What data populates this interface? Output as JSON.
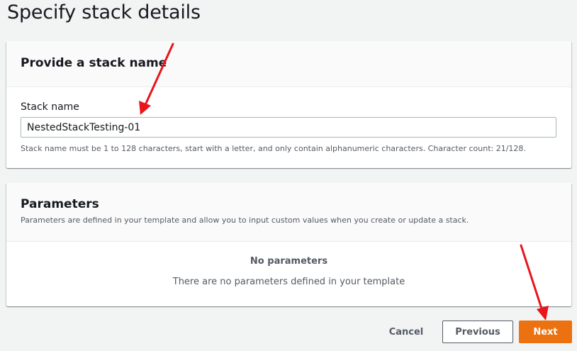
{
  "page": {
    "title": "Specify stack details"
  },
  "stack_name_section": {
    "title": "Provide a stack name",
    "field_label": "Stack name",
    "field_value": "NestedStackTesting-01",
    "constraint": "Stack name must be 1 to 128 characters, start with a letter, and only contain alphanumeric characters. Character count: 21/128."
  },
  "parameters_section": {
    "title": "Parameters",
    "description": "Parameters are defined in your template and allow you to input custom values when you create or update a stack.",
    "empty_title": "No parameters",
    "empty_description": "There are no parameters defined in your template"
  },
  "actions": {
    "cancel_label": "Cancel",
    "previous_label": "Previous",
    "next_label": "Next"
  },
  "colors": {
    "primary_button": "#ec7211",
    "annotation_arrow": "#e8151b",
    "background": "#f2f3f3"
  }
}
